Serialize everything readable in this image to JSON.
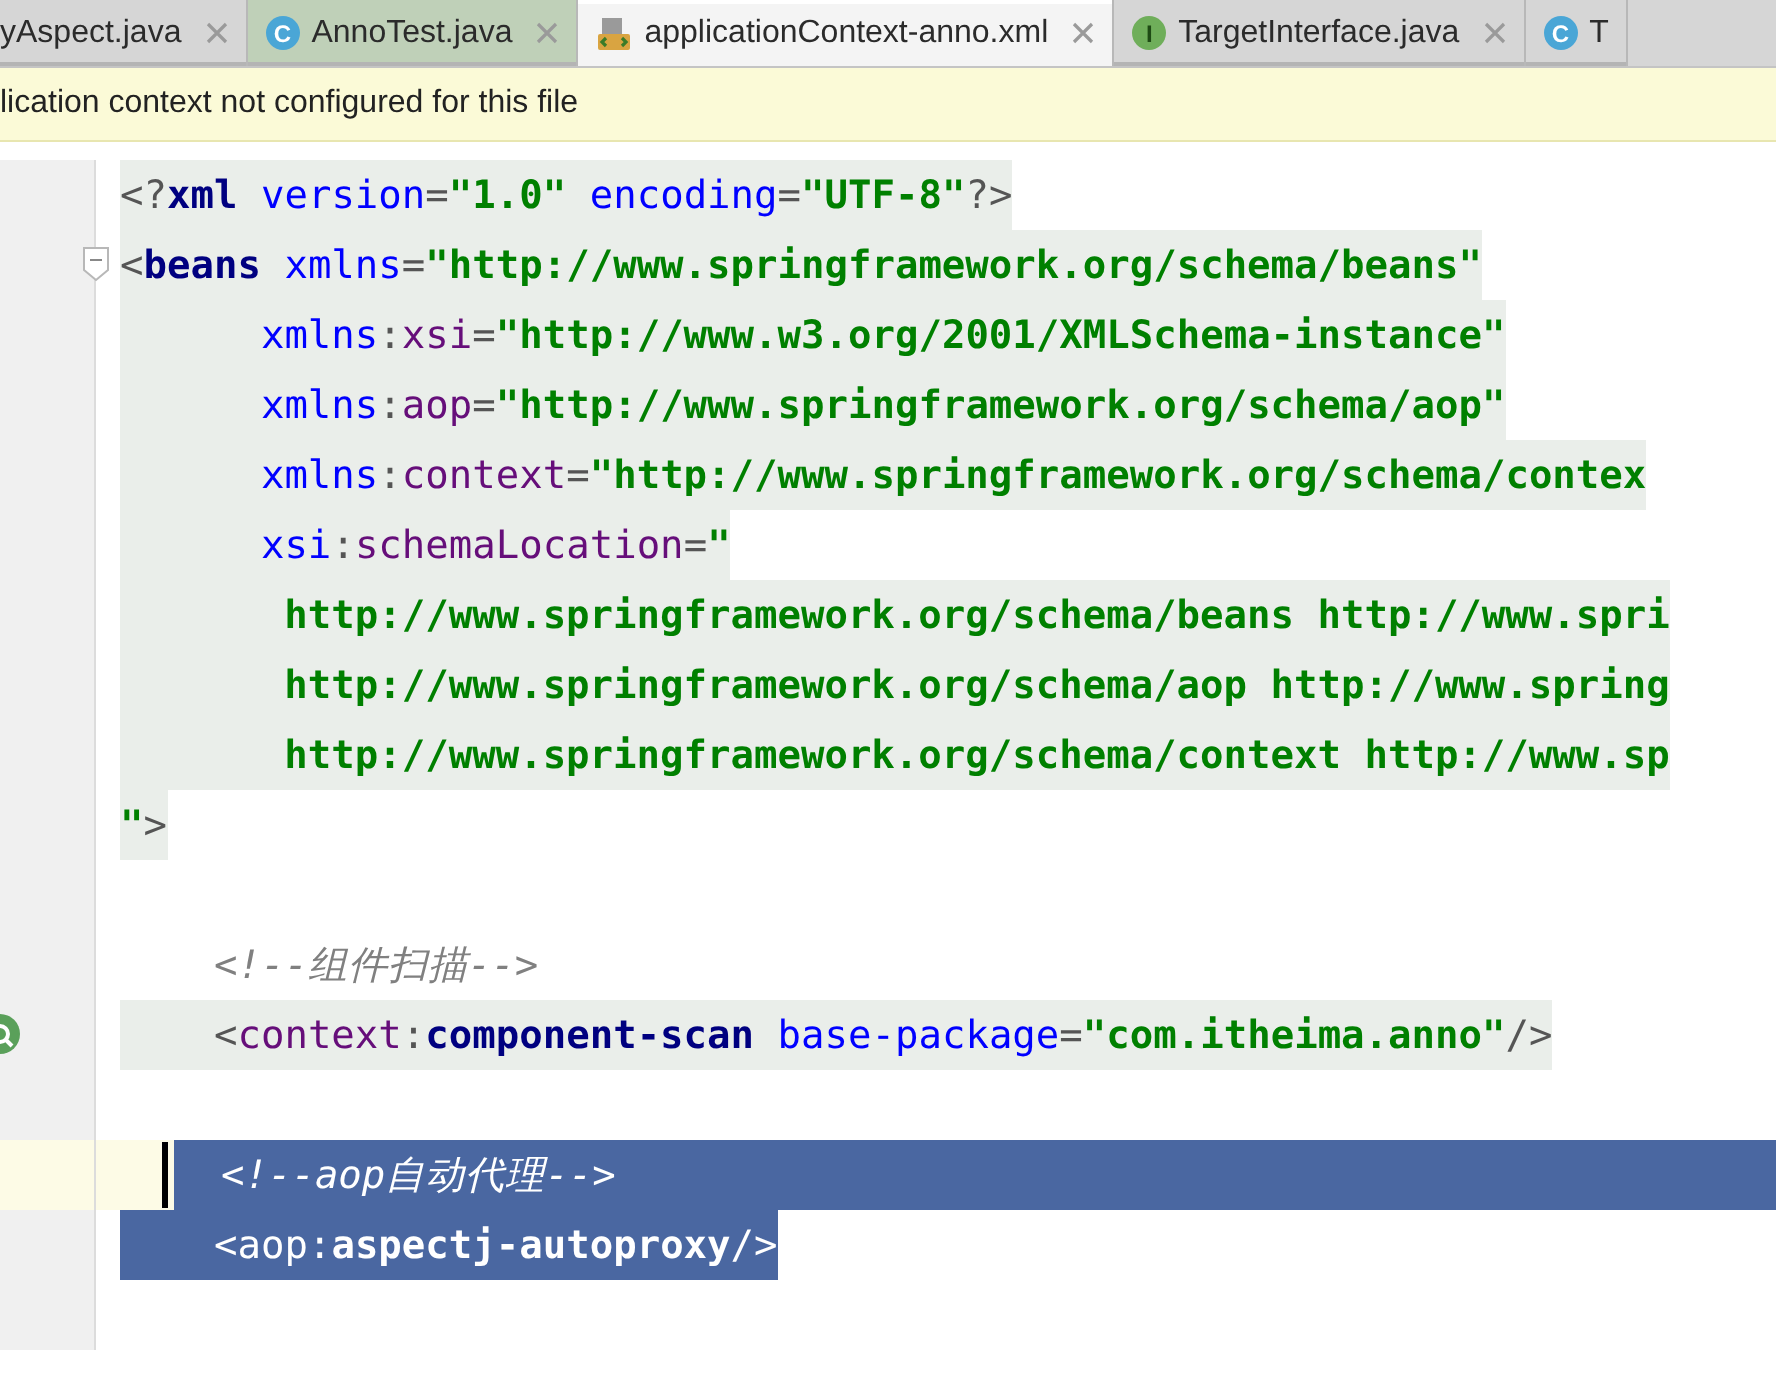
{
  "tabs": [
    {
      "label": "yAspect.java",
      "kind": "plain",
      "color": "#d6d6d6",
      "selected": false,
      "closable": true
    },
    {
      "label": "AnnoTest.java",
      "badge": "C",
      "kind": "class",
      "color": "#bfd0b8",
      "selected": false,
      "closable": true
    },
    {
      "label": "applicationContext-anno.xml",
      "kind": "xml",
      "color": "#f4f4f4",
      "selected": true,
      "closable": true
    },
    {
      "label": "TargetInterface.java",
      "badge": "I",
      "kind": "interface",
      "color": "#d6d6d6",
      "selected": false,
      "closable": true
    },
    {
      "label": "T",
      "badge": "C",
      "kind": "class",
      "color": "#d6d6d6",
      "selected": false,
      "closable": false
    }
  ],
  "banner": {
    "text": "lication context not configured for this file"
  },
  "lines": [
    {
      "kind": "code",
      "text": "<?xml version=\"1.0\" encoding=\"UTF-8\"?>",
      "shaded": true,
      "selected": false
    },
    {
      "kind": "code",
      "fold_marker": true,
      "text": "<beans xmlns=\"http://www.springframework.org/schema/beans\"",
      "shaded": true,
      "selected": false
    },
    {
      "kind": "code",
      "text": "      xmlns:xsi=\"http://www.w3.org/2001/XMLSchema-instance\"",
      "shaded": true,
      "selected": false
    },
    {
      "kind": "code",
      "text": "      xmlns:aop=\"http://www.springframework.org/schema/aop\"",
      "shaded": true,
      "selected": false
    },
    {
      "kind": "code",
      "text": "      xmlns:context=\"http://www.springframework.org/schema/contex",
      "shaded": true,
      "selected": false
    },
    {
      "kind": "code",
      "text": "      xsi:schemaLocation=\"",
      "shaded": true,
      "selected": false
    },
    {
      "kind": "code",
      "text": "       http://www.springframework.org/schema/beans http://www.spri",
      "shaded": true,
      "selected": false
    },
    {
      "kind": "code",
      "text": "       http://www.springframework.org/schema/aop http://www.spring",
      "shaded": true,
      "selected": false
    },
    {
      "kind": "code",
      "text": "       http://www.springframework.org/schema/context http://www.sp",
      "shaded": true,
      "selected": false
    },
    {
      "kind": "code",
      "text": "\">",
      "shaded": true,
      "selected": false
    },
    {
      "kind": "blank"
    },
    {
      "kind": "code",
      "text": "    <!--组件扫描-->",
      "shaded": false,
      "selected": false
    },
    {
      "kind": "code",
      "bean_marker": true,
      "text": "    <context:component-scan base-package=\"com.itheima.anno\"/>",
      "shaded": true,
      "selected": false
    },
    {
      "kind": "blank"
    },
    {
      "kind": "code",
      "text": "  <!--aop自动代理-->",
      "shaded": false,
      "selected": true,
      "current": true,
      "caret": true
    },
    {
      "kind": "code",
      "text": "    <aop:aspectj-autoproxy/>",
      "shaded": false,
      "selected": true
    },
    {
      "kind": "blank"
    }
  ]
}
